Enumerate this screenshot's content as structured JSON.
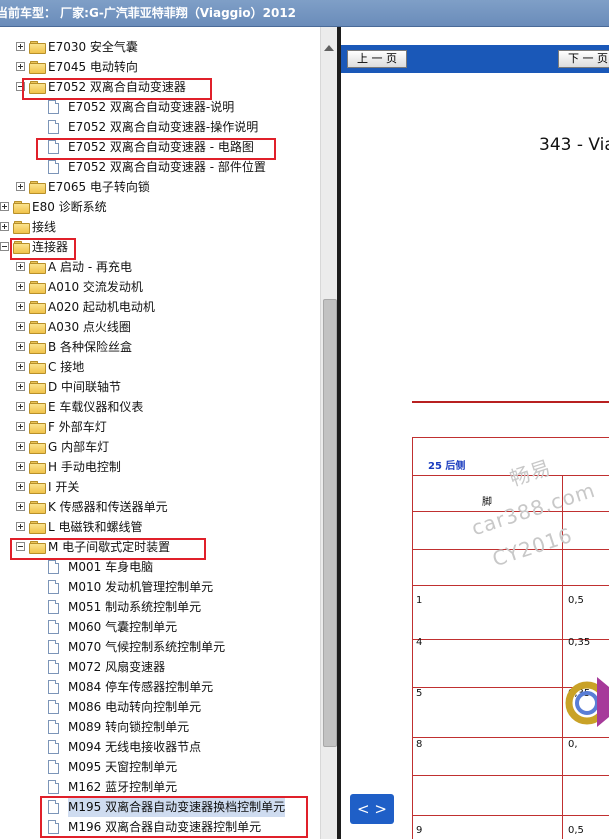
{
  "title_bar": {
    "text": "当前车型：  厂家:G-广汽菲亚特菲翔（Viaggio）2012"
  },
  "tree": {
    "rows": [
      {
        "label": "E7030 安全气囊",
        "kind": "folder",
        "level": 2,
        "state": "plus"
      },
      {
        "label": "E7045 电动转向",
        "kind": "folder",
        "level": 2,
        "state": "plus"
      },
      {
        "label": "E7052 双离合自动变速器",
        "kind": "folder",
        "level": 2,
        "state": "minus"
      },
      {
        "label": "E7052 双离合自动变速器-说明",
        "kind": "doc",
        "level": 3
      },
      {
        "label": "E7052 双离合自动变速器-操作说明",
        "kind": "doc",
        "level": 3
      },
      {
        "label": "E7052 双离合自动变速器 - 电路图",
        "kind": "doc",
        "level": 3
      },
      {
        "label": "E7052 双离合自动变速器 - 部件位置",
        "kind": "doc",
        "level": 3
      },
      {
        "label": "E7065 电子转向锁",
        "kind": "folder",
        "level": 2,
        "state": "plus"
      },
      {
        "label": "E80 诊断系统",
        "kind": "folder",
        "level": 1,
        "state": "plus"
      },
      {
        "label": "接线",
        "kind": "folder",
        "level": 1,
        "state": "plus"
      },
      {
        "label": "连接器",
        "kind": "folder",
        "level": 1,
        "state": "minus"
      },
      {
        "label": "A 启动 - 再充电",
        "kind": "folder",
        "level": 2,
        "state": "plus"
      },
      {
        "label": "A010 交流发动机",
        "kind": "folder",
        "level": 2,
        "state": "plus"
      },
      {
        "label": "A020 起动机电动机",
        "kind": "folder",
        "level": 2,
        "state": "plus"
      },
      {
        "label": "A030 点火线圈",
        "kind": "folder",
        "level": 2,
        "state": "plus"
      },
      {
        "label": "B 各种保险丝盒",
        "kind": "folder",
        "level": 2,
        "state": "plus"
      },
      {
        "label": "C 接地",
        "kind": "folder",
        "level": 2,
        "state": "plus"
      },
      {
        "label": "D 中间联轴节",
        "kind": "folder",
        "level": 2,
        "state": "plus"
      },
      {
        "label": "E 车载仪器和仪表",
        "kind": "folder",
        "level": 2,
        "state": "plus"
      },
      {
        "label": "F 外部车灯",
        "kind": "folder",
        "level": 2,
        "state": "plus"
      },
      {
        "label": "G 内部车灯",
        "kind": "folder",
        "level": 2,
        "state": "plus"
      },
      {
        "label": "H 手动电控制",
        "kind": "folder",
        "level": 2,
        "state": "plus"
      },
      {
        "label": "I 开关",
        "kind": "folder",
        "level": 2,
        "state": "plus"
      },
      {
        "label": "K 传感器和传送器单元",
        "kind": "folder",
        "level": 2,
        "state": "plus"
      },
      {
        "label": "L 电磁铁和螺线管",
        "kind": "folder",
        "level": 2,
        "state": "plus"
      },
      {
        "label": "M 电子间歇式定时装置",
        "kind": "folder",
        "level": 2,
        "state": "minus"
      },
      {
        "label": "M001 车身电脑",
        "kind": "doc",
        "level": 3
      },
      {
        "label": "M010 发动机管理控制单元",
        "kind": "doc",
        "level": 3
      },
      {
        "label": "M051 制动系统控制单元",
        "kind": "doc",
        "level": 3
      },
      {
        "label": "M060 气囊控制单元",
        "kind": "doc",
        "level": 3
      },
      {
        "label": "M070 气候控制系统控制单元",
        "kind": "doc",
        "level": 3
      },
      {
        "label": "M072 风扇变速器",
        "kind": "doc",
        "level": 3
      },
      {
        "label": "M084 停车传感器控制单元",
        "kind": "doc",
        "level": 3
      },
      {
        "label": "M086 电动转向控制单元",
        "kind": "doc",
        "level": 3
      },
      {
        "label": "M089 转向锁控制单元",
        "kind": "doc",
        "level": 3
      },
      {
        "label": "M094 无线电接收器节点",
        "kind": "doc",
        "level": 3
      },
      {
        "label": "M095 天窗控制单元",
        "kind": "doc",
        "level": 3
      },
      {
        "label": "M162 蓝牙控制单元",
        "kind": "doc",
        "level": 3
      },
      {
        "label": "M195 双离合器自动变速器换档控制单元",
        "kind": "doc",
        "level": 3,
        "selected": true
      },
      {
        "label": "M196 双离合器自动变速器控制单元",
        "kind": "doc",
        "level": 3
      }
    ]
  },
  "viewer": {
    "prev_label": "上 一 页",
    "next_label": "下 一 页",
    "page_title": "343 - Via",
    "sheet": {
      "caption": "25 后侧",
      "pin_header": "脚",
      "rows": [
        {
          "pin": "1",
          "value": "0,5"
        },
        {
          "pin": "4",
          "value": "0,35"
        },
        {
          "pin": "5",
          "value": "0,35"
        },
        {
          "pin": "8",
          "value": "0,"
        },
        {
          "pin": "9",
          "value": "0,5"
        }
      ]
    },
    "watermark": {
      "line1": "畅易",
      "line2": "car388.com",
      "line3": "CY2016"
    },
    "nav_button": "< >"
  }
}
